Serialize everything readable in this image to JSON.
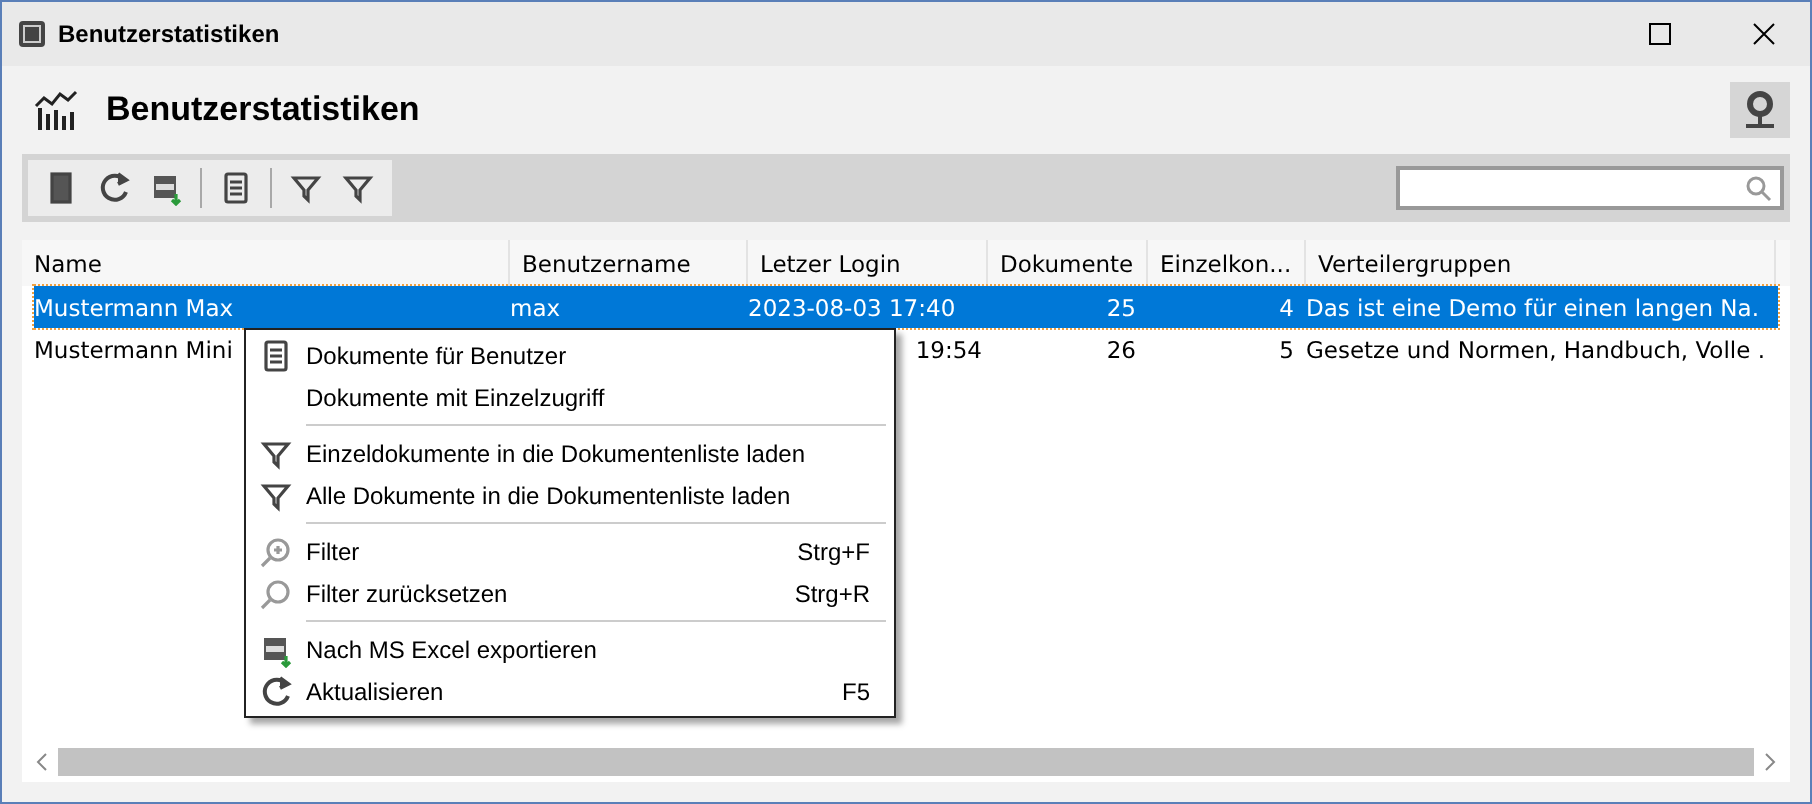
{
  "window": {
    "title": "Benutzerstatistiken"
  },
  "header": {
    "title": "Benutzerstatistiken"
  },
  "table": {
    "columns": [
      "Name",
      "Benutzername",
      "Letzer Login",
      "Dokumente",
      "Einzelkon...",
      "Verteilergruppen"
    ],
    "rows": [
      {
        "selected": true,
        "cells": [
          "Mustermann Max",
          "max",
          "2023-08-03 17:40",
          "25",
          "4",
          "Das ist eine Demo  für einen langen Na."
        ]
      },
      {
        "selected": false,
        "cells": [
          "Mustermann Mini",
          null,
          {
            "text": "19:54",
            "kind": "tail"
          },
          "26",
          "5",
          "Gesetze und Normen, Handbuch, Volle ."
        ]
      }
    ]
  },
  "context_menu": {
    "groups": [
      [
        {
          "label": "Dokumente für Benutzer",
          "kind": "document"
        },
        {
          "label": "Dokumente mit Einzelzugriff",
          "kind": "plain"
        }
      ],
      [
        {
          "label": "Einzeldokumente in die Dokumentenliste laden",
          "kind": "filter"
        },
        {
          "label": "Alle Dokumente in die Dokumentenliste laden",
          "kind": "filter"
        }
      ],
      [
        {
          "label": "Filter",
          "kind": "zoom",
          "shortcut": "Strg+F"
        },
        {
          "label": "Filter zurücksetzen",
          "kind": "search",
          "shortcut": "Strg+R"
        }
      ],
      [
        {
          "label": "Nach MS Excel exportieren",
          "kind": "export"
        },
        {
          "label": "Aktualisieren",
          "kind": "refresh",
          "shortcut": "F5"
        }
      ]
    ]
  }
}
